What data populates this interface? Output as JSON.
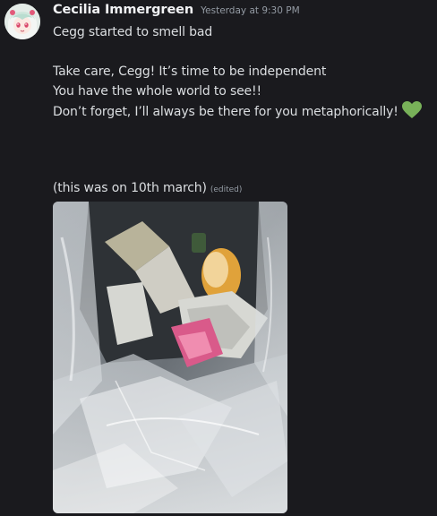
{
  "author": {
    "name": "Cecilia Immergreen",
    "avatar_icon": "anime-avatar-icon"
  },
  "timestamp": "Yesterday at 9:30 PM",
  "lines": {
    "l1": "Cegg started to smell bad",
    "l2": "Take care, Cegg! It’s time to be independent",
    "l3": "You have the whole world to see!!",
    "l4": "Don’t forget, I’ll always be there for you metaphorically!",
    "l5": "(this was on 10th march)"
  },
  "edited_label": "(edited)",
  "emoji": {
    "icon": "green-heart-icon",
    "color": "#78b159"
  },
  "attachment": {
    "icon": "trash-bag-photo"
  },
  "colors": {
    "background": "#1a1a1e",
    "username": "#f2f3f5",
    "text": "#dbdee1",
    "muted": "#949ba4"
  }
}
